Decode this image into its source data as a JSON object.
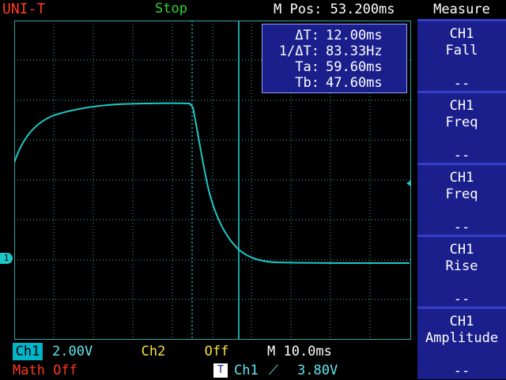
{
  "header": {
    "brand": "UNI-T",
    "status": "Stop",
    "mpos": "M Pos: 53.200ms",
    "measure_title": "Measure"
  },
  "cursor_readout": {
    "rows": [
      {
        "label": "ΔT:",
        "value": "12.00ms"
      },
      {
        "label": "1/ΔT:",
        "value": "83.33Hz"
      },
      {
        "label": "Ta:",
        "value": "59.60ms"
      },
      {
        "label": "Tb:",
        "value": "47.60ms"
      }
    ]
  },
  "menu": {
    "items": [
      {
        "source": "CH1",
        "name": "Fall",
        "value": "--"
      },
      {
        "source": "CH1",
        "name": "Freq",
        "value": "--"
      },
      {
        "source": "CH1",
        "name": "Freq",
        "value": "--"
      },
      {
        "source": "CH1",
        "name": "Rise",
        "value": "--"
      },
      {
        "source": "CH1",
        "name": "Amplitude",
        "value": "--"
      }
    ]
  },
  "bottom": {
    "ch1_tag": "Ch1",
    "ch1_scale": "2.00V",
    "ch2_tag": "Ch2",
    "ch2_value": "Off",
    "timebase": "M 10.0ms",
    "math": "Math Off",
    "trigger_tag": "T",
    "trigger_source": "Ch1",
    "trigger_slope": "⟋",
    "trigger_level": "3.80V"
  },
  "scope": {
    "ch1_marker": "1",
    "colors": {
      "trace": "#1ec8c8",
      "grid": "#2f8f8f",
      "frame": "#3aa0a0",
      "cursor": "#1ec8c8"
    },
    "trace_description_points": "rise-plateau-fall-settle"
  }
}
